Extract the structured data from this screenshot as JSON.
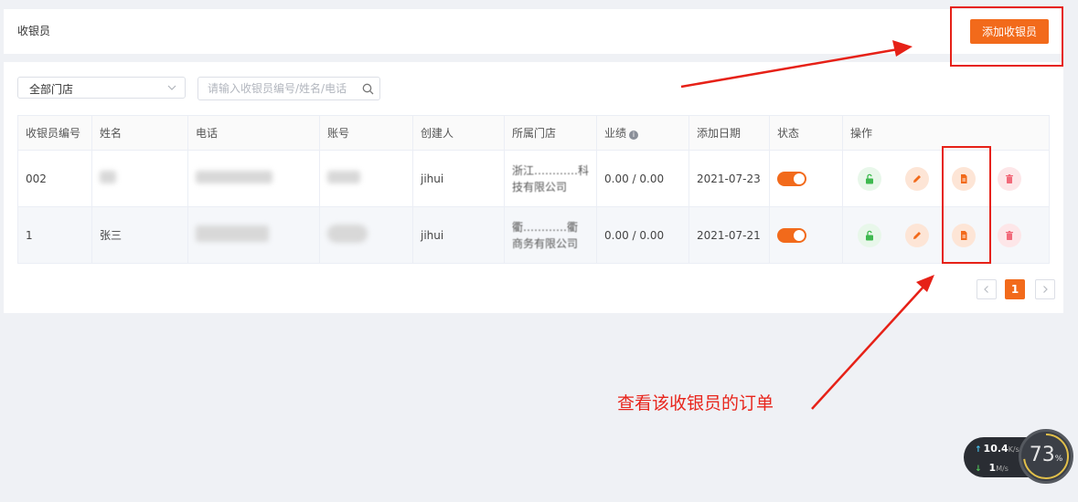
{
  "header": {
    "title": "收银员",
    "add_button_label": "添加收银员"
  },
  "filters": {
    "store_select_value": "全部门店",
    "search_placeholder": "请输入收银员编号/姓名/电话"
  },
  "table": {
    "columns": [
      "收银员编号",
      "姓名",
      "电话",
      "账号",
      "创建人",
      "所属门店",
      "业绩",
      "添加日期",
      "状态",
      "操作"
    ],
    "rows": [
      {
        "id": "002",
        "name": "",
        "creator": "jihui",
        "store_line1": "浙江…………科",
        "store_line2": "技有限公司",
        "performance": "0.00 / 0.00",
        "date": "2021-07-23",
        "status_on": true
      },
      {
        "id": "1",
        "name": "张三",
        "creator": "jihui",
        "store_line1": "衢…………衢",
        "store_line2": "商务有限公司",
        "performance": "0.00 / 0.00",
        "date": "2021-07-21",
        "status_on": true
      }
    ]
  },
  "pagination": {
    "current_page": "1"
  },
  "annotation": {
    "text": "查看该收银员的订单"
  },
  "net_widget": {
    "upload_value": "10.4",
    "upload_unit": "K/s",
    "download_value": "1",
    "download_unit": "M/s",
    "gauge_value": "73",
    "gauge_unit": "%"
  },
  "colors": {
    "accent": "#f26a1b",
    "annotation_red": "#e62117"
  }
}
